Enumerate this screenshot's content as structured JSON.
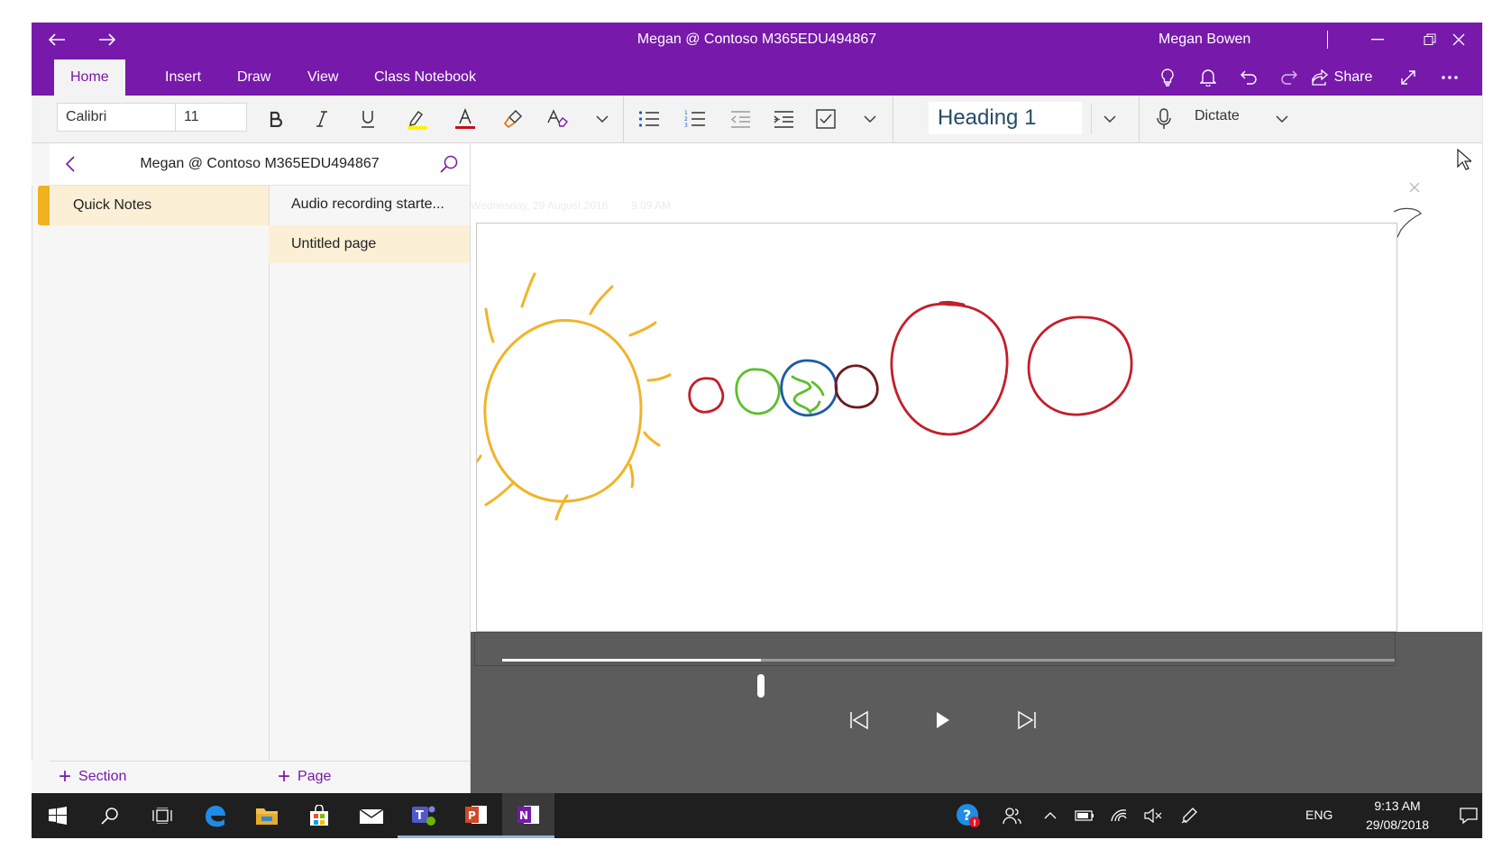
{
  "window": {
    "title": "Megan @ Contoso M365EDU494867",
    "user": "Megan Bowen",
    "tabs": [
      "Home",
      "Insert",
      "Draw",
      "View",
      "Class Notebook"
    ],
    "active_tab": "Home",
    "share_label": "Share"
  },
  "ribbon": {
    "font_name": "Calibri",
    "font_size": "11",
    "style": "Heading 1",
    "dictate_label": "Dictate"
  },
  "nav": {
    "notebook": "Megan @ Contoso M365EDU494867",
    "sections": [
      {
        "label": "Quick Notes",
        "color": "#f0b21f"
      }
    ],
    "pages": [
      "Audio recording starte...",
      "Untitled page"
    ],
    "selected_page": 1,
    "add_section_label": "Section",
    "add_page_label": "Page"
  },
  "page": {
    "ghost_date": "Wednesday, 29 August 2018",
    "ghost_time": "9:09 AM"
  },
  "player": {
    "progress": 0.29
  },
  "taskbar": {
    "language": "ENG",
    "time": "9:13 AM",
    "date": "29/08/2018"
  },
  "colors": {
    "accent": "#7719aa",
    "sun": "#f0b429",
    "red_circle": "#c21f2b",
    "green_circle": "#5cbf2a",
    "blue_circle": "#1e5aa8",
    "dark_red_circle": "#6e1a1e"
  }
}
